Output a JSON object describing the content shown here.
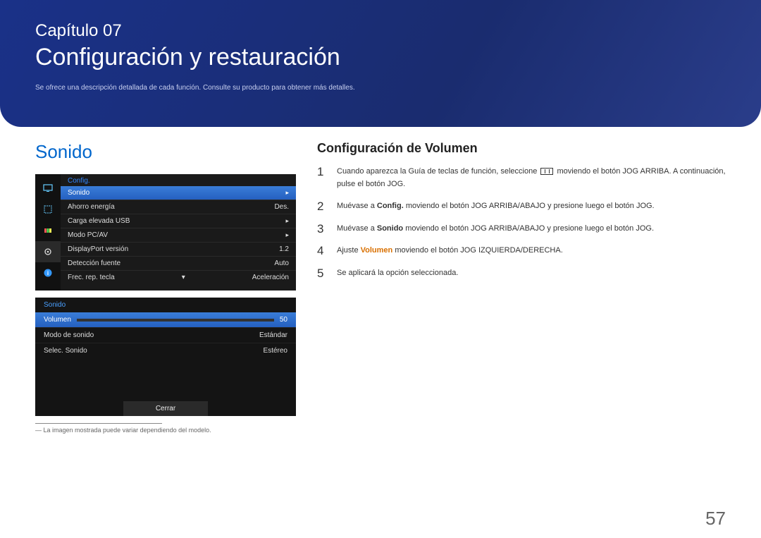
{
  "header": {
    "chapter": "Capítulo 07",
    "title": "Configuración y restauración",
    "subtitle": "Se ofrece una descripción detallada de cada función. Consulte su producto para obtener más detalles."
  },
  "section": {
    "title": "Sonido"
  },
  "osd_top": {
    "header": "Config.",
    "rows": [
      {
        "label": "Sonido",
        "value": "▸",
        "highlight": true
      },
      {
        "label": "Ahorro energía",
        "value": "Des."
      },
      {
        "label": "Carga elevada USB",
        "value": "▸"
      },
      {
        "label": "Modo PC/AV",
        "value": "▸"
      },
      {
        "label": "DisplayPort versión",
        "value": "1.2"
      },
      {
        "label": "Detección fuente",
        "value": "Auto"
      },
      {
        "label": "Frec. rep. tecla",
        "value": "Aceleración"
      }
    ]
  },
  "osd_bottom": {
    "title": "Sonido",
    "rows": [
      {
        "label": "Volumen",
        "value": "50",
        "highlight": true,
        "slider": true
      },
      {
        "label": "Modo de sonido",
        "value": "Estándar"
      },
      {
        "label": "Selec. Sonido",
        "value": "Estéreo"
      }
    ],
    "close": "Cerrar"
  },
  "footnote": "― La imagen mostrada puede variar dependiendo del modelo.",
  "right": {
    "title": "Configuración de Volumen",
    "steps": {
      "s1a": "Cuando aparezca la Guía de teclas de función, seleccione ",
      "s1b": " moviendo el botón JOG ARRIBA. A continuación, pulse el botón JOG.",
      "s2a": "Muévase a ",
      "s2b": "Config.",
      "s2c": " moviendo el botón JOG ARRIBA/ABAJO y presione luego el botón JOG.",
      "s3a": "Muévase a ",
      "s3b": "Sonido",
      "s3c": " moviendo el botón JOG ARRIBA/ABAJO y presione luego el botón JOG.",
      "s4a": "Ajuste ",
      "s4b": "Volumen",
      "s4c": " moviendo el botón JOG IZQUIERDA/DERECHA.",
      "s5": "Se aplicará la opción seleccionada."
    }
  },
  "page_number": "57"
}
